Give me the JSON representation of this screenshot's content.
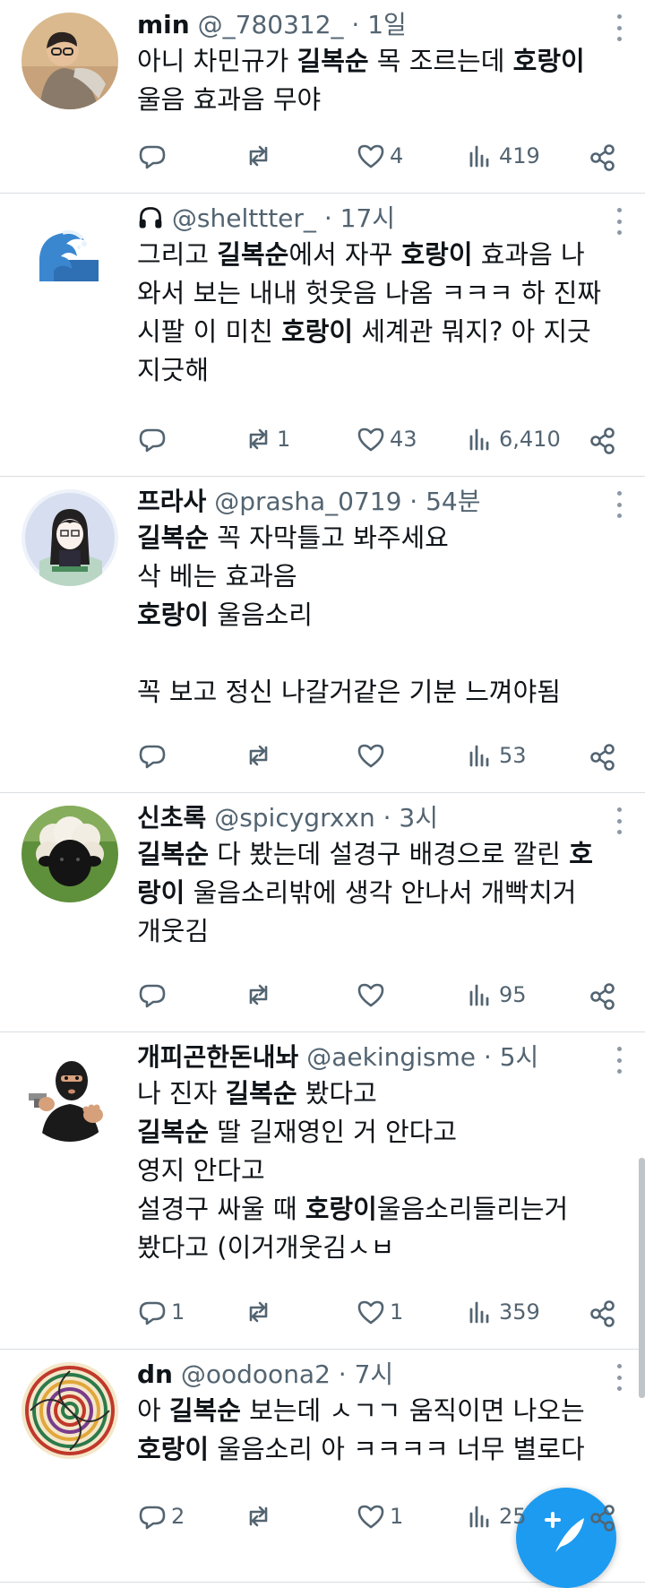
{
  "tweets": [
    {
      "name": "min",
      "handle": "@_780312_",
      "time": "1일",
      "lines": [
        [
          {
            "t": "아니 차민규가 ",
            "b": false
          },
          {
            "t": "길복순",
            "b": true
          },
          {
            "t": " 목 조르는데 ",
            "b": false
          },
          {
            "t": "호랑이",
            "b": true
          }
        ],
        [
          {
            "t": "울음 효과음 무야",
            "b": false
          }
        ]
      ],
      "replies": "",
      "retweets": "",
      "likes": "4",
      "views": "419",
      "avatar_icon": "person-avatar-icon"
    },
    {
      "name": "",
      "handle": "@shelttter_",
      "time": "17시",
      "lines": [
        [
          {
            "t": "그리고 ",
            "b": false
          },
          {
            "t": "길복순",
            "b": true
          },
          {
            "t": "에서 자꾸 ",
            "b": false
          },
          {
            "t": "호랑이",
            "b": true
          },
          {
            "t": " 효과음 나",
            "b": false
          }
        ],
        [
          {
            "t": "와서 보는 내내 헛웃음 나옴 ㅋㅋㅋ 하 진짜",
            "b": false
          }
        ],
        [
          {
            "t": "시팔 이 미친 ",
            "b": false
          },
          {
            "t": "호랑이",
            "b": true
          },
          {
            "t": " 세계관 뭐지? 아 지긋",
            "b": false
          }
        ],
        [
          {
            "t": "지긋해",
            "b": false
          }
        ]
      ],
      "replies": "",
      "retweets": "1",
      "likes": "43",
      "views": "6,410",
      "avatar_icon": "wave-avatar-icon"
    },
    {
      "name": "프라사",
      "handle": "@prasha_0719",
      "time": "54분",
      "lines": [
        [
          {
            "t": "길복순",
            "b": true
          },
          {
            "t": " 꼭 자막틀고 봐주세요",
            "b": false
          }
        ],
        [
          {
            "t": "삭 베는 효과음",
            "b": false
          }
        ],
        [
          {
            "t": "호랑이",
            "b": true
          },
          {
            "t": " 울음소리",
            "b": false
          }
        ],
        [],
        [
          {
            "t": "꼭 보고 정신 나갈거같은 기분 느껴야됨",
            "b": false
          }
        ]
      ],
      "replies": "",
      "retweets": "",
      "likes": "",
      "views": "53",
      "avatar_icon": "anime-avatar-icon"
    },
    {
      "name": "신초록",
      "handle": "@spicygrxxn",
      "time": "3시",
      "lines": [
        [
          {
            "t": "길복순",
            "b": true
          },
          {
            "t": " 다 봤는데 설경구 배경으로 깔린 ",
            "b": false
          },
          {
            "t": "호",
            "b": true
          }
        ],
        [
          {
            "t": "랑이",
            "b": true
          },
          {
            "t": " 울음소리밖에 생각 안나서 개빡치거",
            "b": false
          }
        ],
        [
          {
            "t": "개웃김",
            "b": false
          }
        ]
      ],
      "replies": "",
      "retweets": "",
      "likes": "",
      "views": "95",
      "avatar_icon": "sheep-avatar-icon"
    },
    {
      "name": "개피곤한돈내놔",
      "handle": "@aekingisme",
      "time": "5시",
      "lines": [
        [
          {
            "t": "나 진자 ",
            "b": false
          },
          {
            "t": "길복순",
            "b": true
          },
          {
            "t": " 봤다고",
            "b": false
          }
        ],
        [
          {
            "t": "길복순",
            "b": true
          },
          {
            "t": " 딸 길재영인 거 안다고",
            "b": false
          }
        ],
        [
          {
            "t": "영지 안다고",
            "b": false
          }
        ],
        [
          {
            "t": "설경구 싸울 때 ",
            "b": false
          },
          {
            "t": "호랑이",
            "b": true
          },
          {
            "t": "울음소리들리는거",
            "b": false
          }
        ],
        [
          {
            "t": "봤다고 (이거개웃김ㅅㅂ",
            "b": false
          }
        ]
      ],
      "replies": "1",
      "retweets": "",
      "likes": "1",
      "views": "359",
      "avatar_icon": "robber-avatar-icon"
    },
    {
      "name": "dn",
      "handle": "@oodoona2",
      "time": "7시",
      "lines": [
        [
          {
            "t": "아 ",
            "b": false
          },
          {
            "t": "길복순",
            "b": true
          },
          {
            "t": " 보는데 ㅅㄱㄱ 움직이면 나오는",
            "b": false
          }
        ],
        [
          {
            "t": "호랑이",
            "b": true
          },
          {
            "t": " 울음소리 아 ㅋㅋㅋㅋ 너무 별로다",
            "b": false
          }
        ]
      ],
      "replies": "2",
      "retweets": "",
      "likes": "1",
      "views": "25",
      "avatar_icon": "psychedelic-avatar-icon"
    }
  ],
  "colors": {
    "text": "#0f1419",
    "secondary": "#536471",
    "divider": "#d9dee2",
    "accent": "#1d9bf0"
  },
  "compose_icon": "compose-tweet-icon"
}
